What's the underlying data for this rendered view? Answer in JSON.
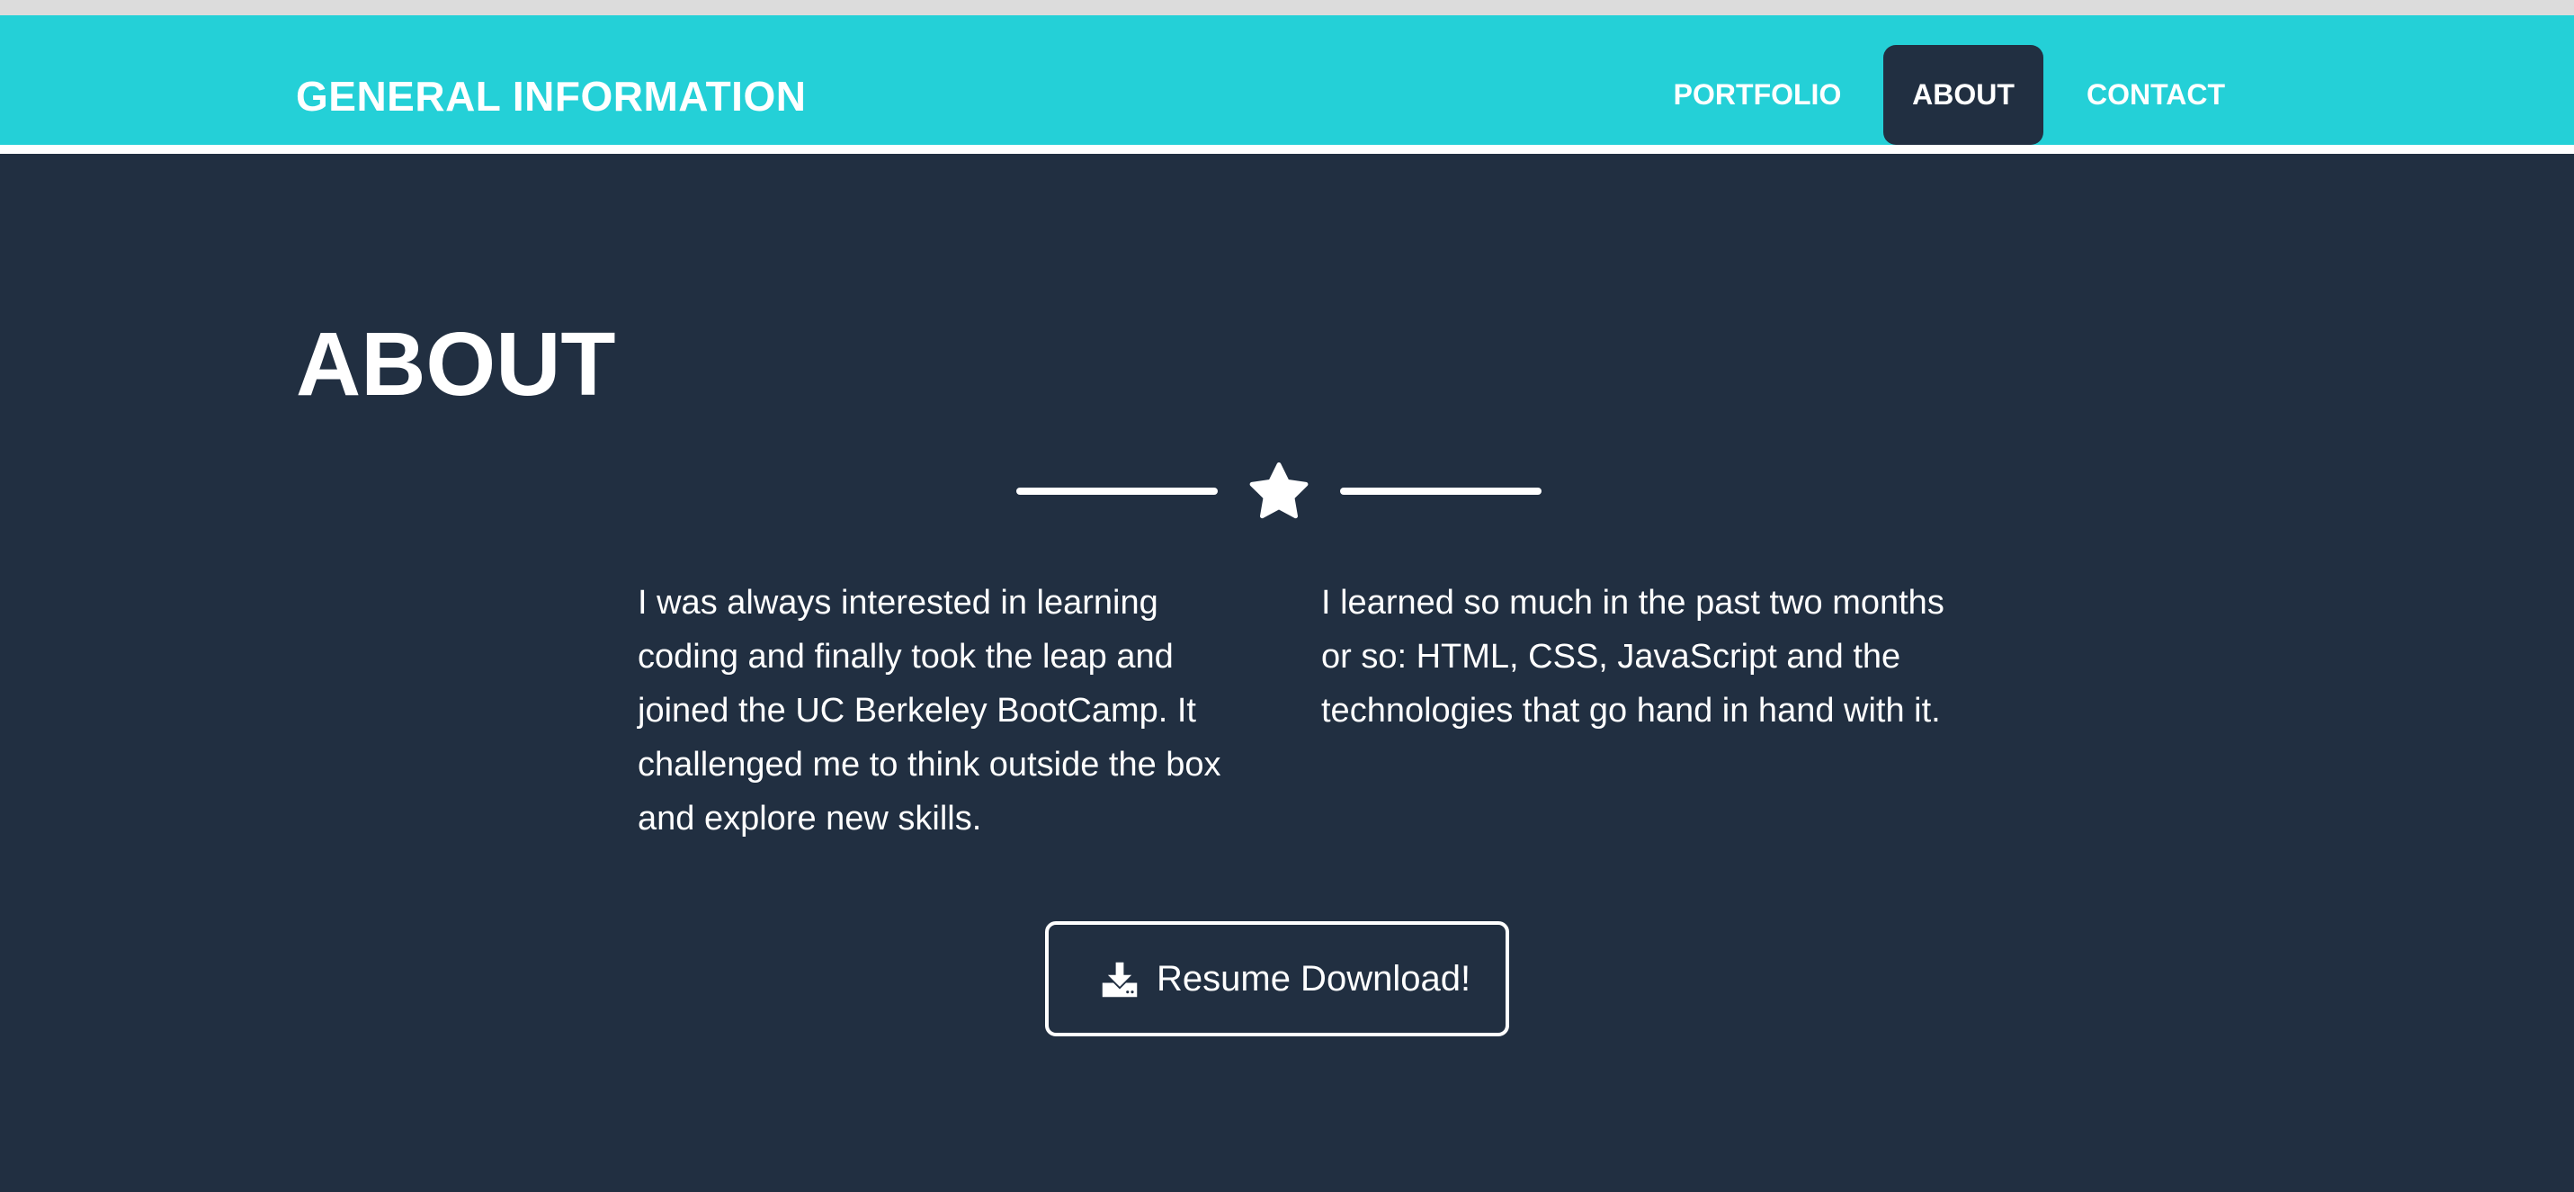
{
  "colors": {
    "navbar": "#24d0d7",
    "background": "#212f41",
    "text": "#ffffff"
  },
  "navbar": {
    "brand": "GENERAL INFORMATION",
    "links": [
      {
        "label": "PORTFOLIO",
        "active": false
      },
      {
        "label": "ABOUT",
        "active": true
      },
      {
        "label": "CONTACT",
        "active": false
      }
    ]
  },
  "about": {
    "title": "ABOUT",
    "divider_icon": "star-icon",
    "paragraphs": [
      "I was always interested in learning coding and finally took the leap and joined the UC Berkeley BootCamp. It challenged me to think outside the box and explore new skills.",
      "I learned so much in the past two months or so: HTML, CSS, JavaScript and the technologies that go hand in hand with it."
    ],
    "resume_button": {
      "label": "Resume Download!",
      "icon": "download-icon"
    }
  }
}
